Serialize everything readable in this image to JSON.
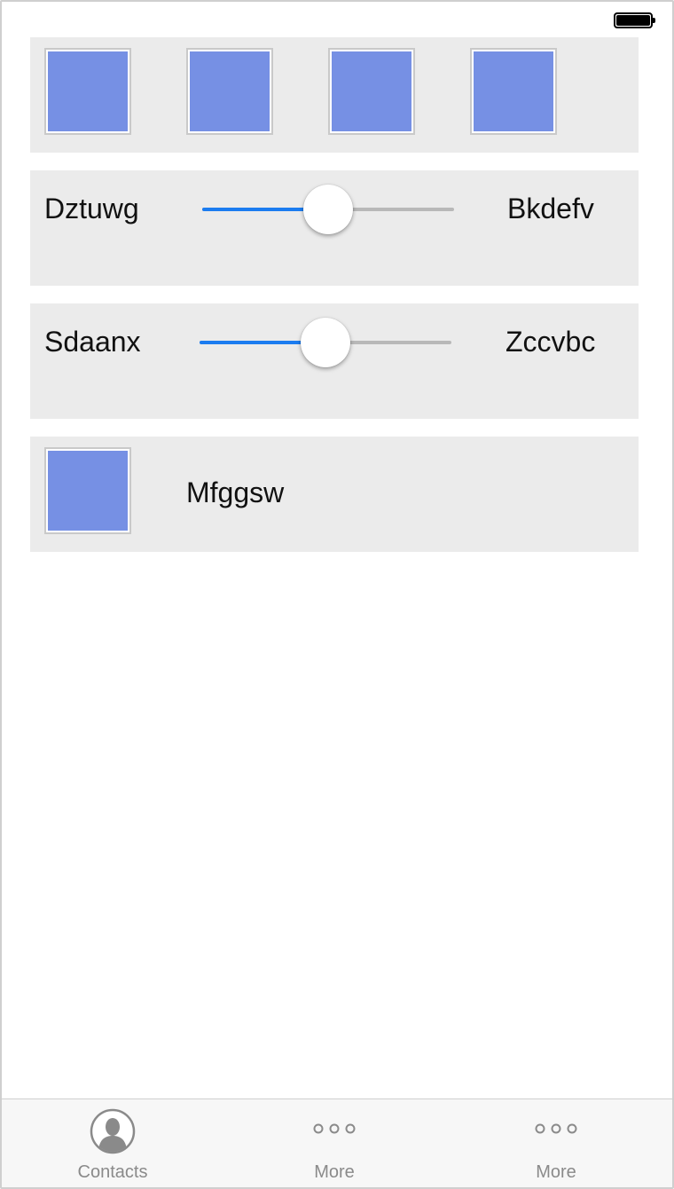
{
  "status_bar": {
    "battery_icon": "battery-full-icon"
  },
  "image_row": {
    "thumbnails": [
      "image-placeholder",
      "image-placeholder",
      "image-placeholder",
      "image-placeholder"
    ],
    "thumbnail_color": "#7690e4"
  },
  "slider_one": {
    "left_label": "Dztuwg",
    "right_label": "Bkdefv",
    "value": 0.5
  },
  "slider_two": {
    "left_label": "Sdaanx",
    "right_label": "Zccvbc",
    "value": 0.5
  },
  "list_item": {
    "label": "Mfggsw",
    "thumbnail": "image-placeholder"
  },
  "tab_bar": {
    "tabs": [
      {
        "label": "Contacts",
        "icon": "contacts-icon"
      },
      {
        "label": "More",
        "icon": "more-icon"
      },
      {
        "label": "More",
        "icon": "more-icon"
      }
    ]
  },
  "colors": {
    "accent": "#1b7cf0",
    "panel_bg": "#ebebeb",
    "tab_label": "#8a8a8a"
  }
}
